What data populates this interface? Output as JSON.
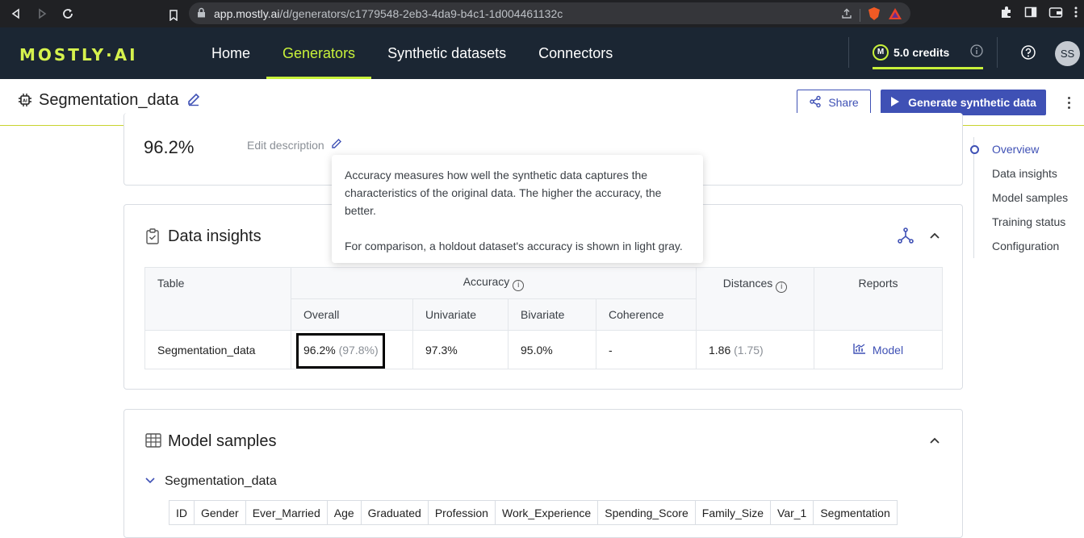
{
  "browser": {
    "url_host": "app.mostly.ai",
    "url_path": "/d/generators/c1779548-2eb3-4da9-b4c1-1d004461132c"
  },
  "header": {
    "logo": "MOSTLY·AI",
    "nav": [
      {
        "label": "Home"
      },
      {
        "label": "Generators"
      },
      {
        "label": "Synthetic datasets"
      },
      {
        "label": "Connectors"
      }
    ],
    "credits_badge": "M",
    "credits": "5.0 credits",
    "avatar": "SS"
  },
  "title_bar": {
    "title": "Segmentation_data",
    "share": "Share",
    "generate": "Generate synthetic data"
  },
  "overview": {
    "accuracy": "96.2%",
    "edit_description": "Edit description"
  },
  "tooltip": {
    "para1": "Accuracy measures how well the synthetic data captures the characteristics of the original data. The higher the accuracy, the better.",
    "para2": "For comparison, a holdout dataset's accuracy is shown in light gray."
  },
  "insights": {
    "title": "Data insights",
    "headers": {
      "table": "Table",
      "accuracy": "Accuracy",
      "distances": "Distances",
      "reports": "Reports",
      "overall": "Overall",
      "univariate": "Univariate",
      "bivariate": "Bivariate",
      "coherence": "Coherence"
    },
    "row": {
      "table": "Segmentation_data",
      "overall": "96.2%",
      "overall_holdout": "(97.8%)",
      "univariate": "97.3%",
      "bivariate": "95.0%",
      "coherence": "-",
      "distances": "1.86",
      "distances_holdout": "(1.75)",
      "report": "Model"
    }
  },
  "samples": {
    "title": "Model samples",
    "table_name": "Segmentation_data",
    "columns": [
      "ID",
      "Gender",
      "Ever_Married",
      "Age",
      "Graduated",
      "Profession",
      "Work_Experience",
      "Spending_Score",
      "Family_Size",
      "Var_1",
      "Segmentation"
    ]
  },
  "toc": [
    {
      "label": "Overview"
    },
    {
      "label": "Data insights"
    },
    {
      "label": "Model samples"
    },
    {
      "label": "Training status"
    },
    {
      "label": "Configuration"
    }
  ]
}
